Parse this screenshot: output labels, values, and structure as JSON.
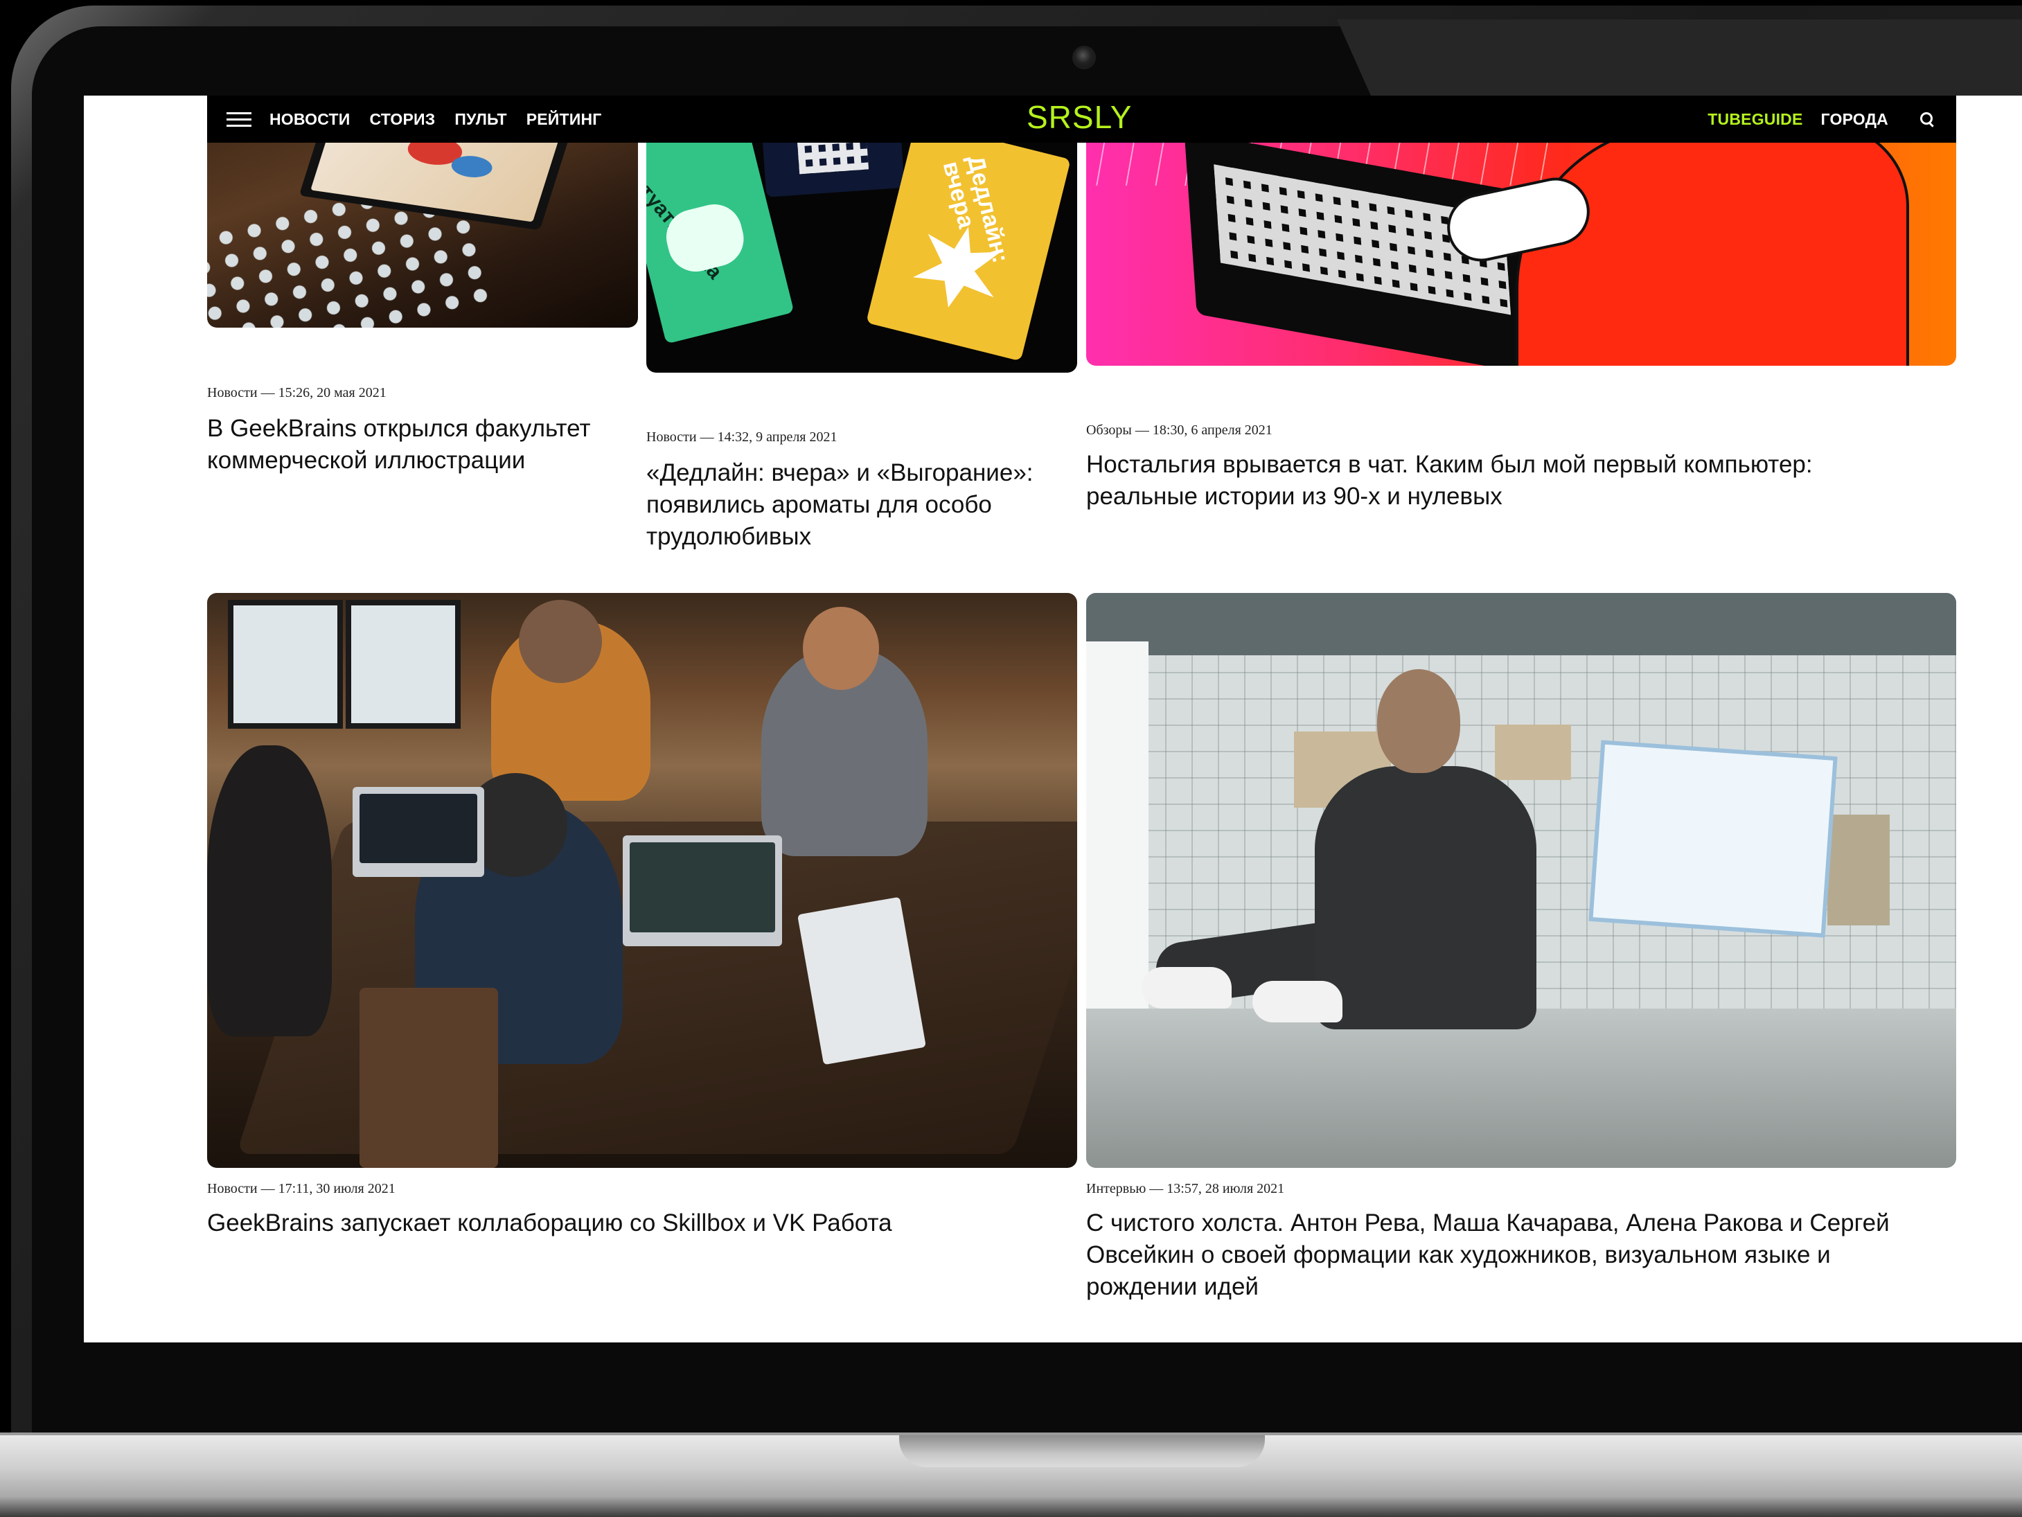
{
  "nav": {
    "left_links": [
      "НОВОСТИ",
      "СТОРИЗ",
      "ПУЛЬТ",
      "РЕЙТИНГ"
    ],
    "logo": "SRSLY",
    "right_links": [
      "TUBEGUIDE",
      "ГОРОДА"
    ],
    "accent_color": "#b6f21c"
  },
  "cards": [
    {
      "meta": "Новости — 15:26, 20 мая 2021",
      "title": "В GeekBrains открылся факультет коммерческой иллюстрации"
    },
    {
      "meta": "Новости — 14:32, 9 апреля 2021",
      "title": "«Дедлайн: вчера» и «Выгорание»: появились ароматы для особо трудолюбивых",
      "image_text": [
        "Ситуативочка",
        "Дедлайн: вчера"
      ]
    },
    {
      "meta": "Обзоры — 18:30, 6 апреля 2021",
      "title": "Ностальгия врывается в чат. Каким был мой первый компьютер: реальные истории из 90-х и нулевых"
    },
    {
      "meta": "Новости — 17:11, 30 июля 2021",
      "title": "GeekBrains запускает коллаборацию со Skillbox и VK Работа"
    },
    {
      "meta": "Интервью — 13:57, 28 июля 2021",
      "title": "С чистого холста. Антон Рева, Маша Качарава, Алена Ракова и Сергей Овсейкин о своей формации как художников, визуальном языке и рождении идей"
    }
  ]
}
